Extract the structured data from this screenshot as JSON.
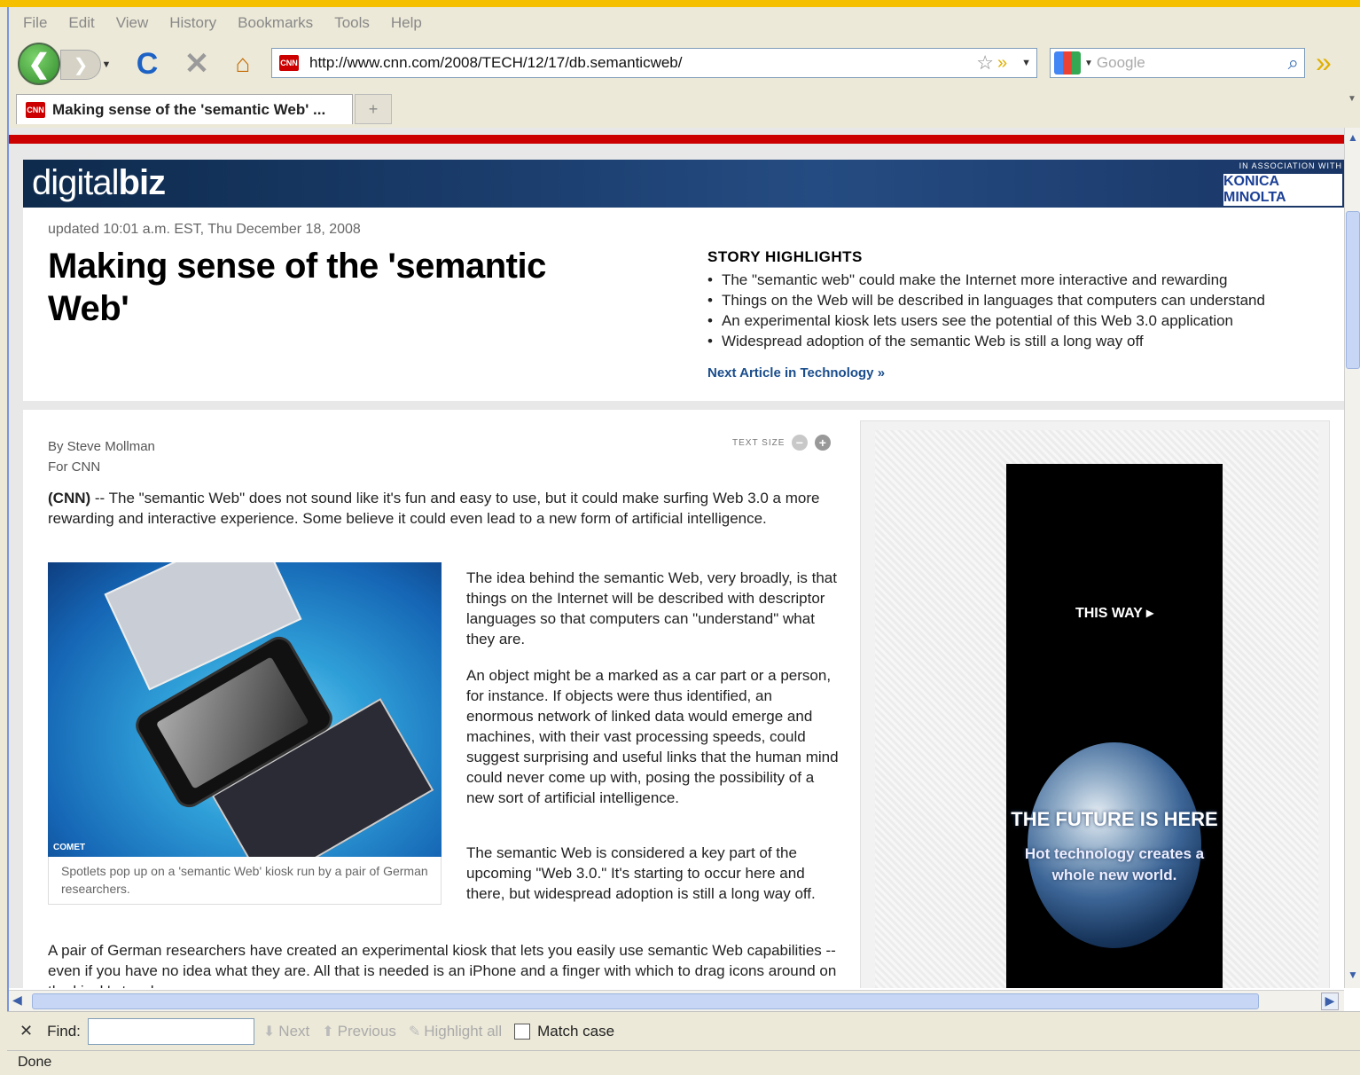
{
  "browser": {
    "menu": [
      "File",
      "Edit",
      "View",
      "History",
      "Bookmarks",
      "Tools",
      "Help"
    ],
    "url": "http://www.cnn.com/2008/TECH/12/17/db.semanticweb/",
    "favicon_text": "CNN",
    "search_placeholder": "Google",
    "tab_title": "Making sense of the 'semantic Web' ...",
    "new_tab": "+",
    "back_glyph": "❮",
    "forward_glyph": "❯",
    "reload_glyph": "C",
    "stop_glyph": "✕",
    "home_glyph": "⌂"
  },
  "banner": {
    "logo_light": "digital",
    "logo_bold": "biz",
    "assoc": "IN ASSOCIATION WITH",
    "sponsor": "KONICA MINOLTA"
  },
  "article": {
    "updated": "updated 10:01 a.m. EST, Thu December 18, 2008",
    "headline": "Making sense of the 'semantic Web'",
    "highlights_title": "STORY HIGHLIGHTS",
    "highlights": [
      "The \"semantic web\" could make the Internet more interactive and rewarding",
      "Things on the Web will be described in languages that computers can understand",
      "An experimental kiosk lets users see the potential of this Web 3.0 application",
      "Widespread adoption of the semantic Web is still a long way off"
    ],
    "next_article": "Next Article in Technology »",
    "byline": "By Steve Mollman",
    "byline_for": "For CNN",
    "text_size": "TEXT SIZE",
    "intro_lead": "(CNN)",
    "intro": " -- The \"semantic Web\" does not sound like it's fun and easy to use, but it could make surfing Web 3.0 a more rewarding and interactive experience. Some believe it could even lead to a new form of artificial intelligence.",
    "photo_credit": "COMET",
    "caption": "Spotlets pop up on a 'semantic Web' kiosk run by a pair of German researchers.",
    "paragraphs": [
      "The idea behind the semantic Web, very broadly, is that things on the Internet will be described with descriptor languages so that computers can \"understand\" what they are.",
      "An object might be a marked as a car part or a person, for instance. If objects were thus identified, an enormous network of linked data would emerge and machines, with their vast processing speeds, could suggest surprising and useful links that the human mind could never come up with, posing the possibility of a new sort of artificial intelligence.",
      "The semantic Web is considered a key part of the upcoming \"Web 3.0.\" It's starting to occur here and there, but widespread adoption is still a long way off.",
      "A pair of German researchers have created an experimental kiosk that lets you easily use semantic Web capabilities -- even if you have no idea what they are. All that is needed is an iPhone and a finger with which to drag icons around on the kiosk's touch screen."
    ]
  },
  "ad": {
    "this_way": "THIS WAY ▸",
    "headline": "THE FUTURE IS HERE",
    "sub": "Hot technology creates a whole new world."
  },
  "findbar": {
    "close": "✕",
    "label": "Find:",
    "next": "Next",
    "previous": "Previous",
    "highlight": "Highlight all",
    "match_case": "Match case"
  },
  "status": "Done"
}
